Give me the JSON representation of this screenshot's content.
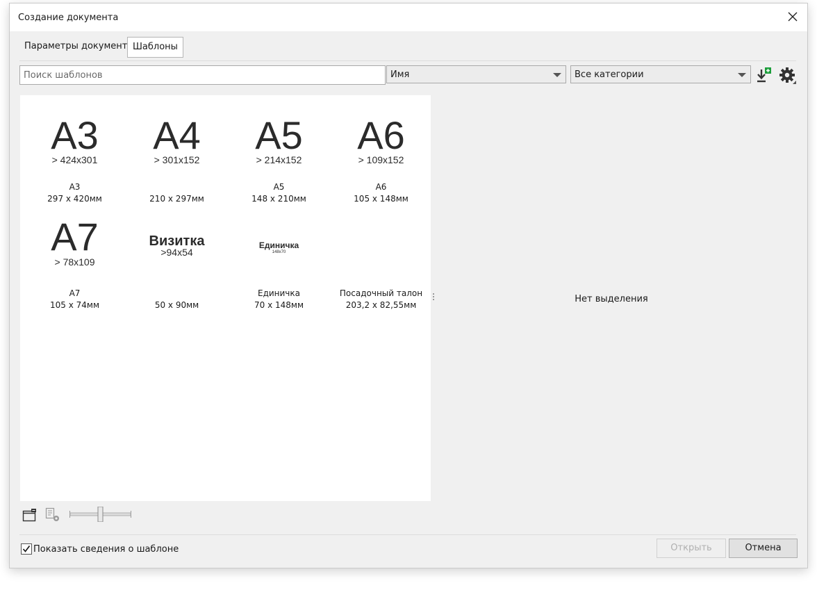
{
  "window": {
    "title": "Создание документа"
  },
  "tabs": [
    {
      "label": "Параметры документа",
      "active": false
    },
    {
      "label": "Шаблоны",
      "active": true
    }
  ],
  "search": {
    "placeholder": "Поиск шаблонов",
    "value": ""
  },
  "sort_select": {
    "value": "Имя"
  },
  "category_select": {
    "value": "Все категории"
  },
  "toolbar_icons": [
    "import-template-icon",
    "settings-gear-icon"
  ],
  "templates": [
    {
      "thumb_title": "A3",
      "thumb_sub": "> 424x301",
      "name": "A3",
      "dims": "297 x 420мм"
    },
    {
      "thumb_title": "A4",
      "thumb_sub": "> 301x152",
      "name": "",
      "dims": "210 x 297мм"
    },
    {
      "thumb_title": "A5",
      "thumb_sub": "> 214x152",
      "name": "A5",
      "dims": "148 x 210мм"
    },
    {
      "thumb_title": "A6",
      "thumb_sub": "> 109x152",
      "name": "A6",
      "dims": "105 x 148мм"
    },
    {
      "thumb_title": "A7",
      "thumb_sub": "> 78x109",
      "name": "A7",
      "dims": "105 x 74мм"
    },
    {
      "thumb_title": "Визитка",
      "thumb_sub": ">94x54",
      "name": "",
      "dims": "50 x 90мм"
    },
    {
      "thumb_title": "Единичка",
      "thumb_sub": "148x70",
      "name": "Единичка",
      "dims": "70 x 148мм"
    },
    {
      "thumb_title": "",
      "thumb_sub": "",
      "name": "Посадочный талон",
      "dims": "203,2 x 82,55мм"
    }
  ],
  "details_panel": {
    "empty_text": "Нет выделения"
  },
  "bottom_toolbar": {
    "icons": [
      "open-template-folder-icon",
      "template-properties-icon"
    ],
    "zoom_slider": {
      "level": 0.5
    }
  },
  "show_info": {
    "label": "Показать сведения о шаблоне",
    "checked": true
  },
  "buttons": {
    "open": "Открыть",
    "cancel": "Отмена"
  },
  "colors": {
    "import_badge": "#1c9e3b",
    "dialog_bg": "#f0f0f0"
  }
}
